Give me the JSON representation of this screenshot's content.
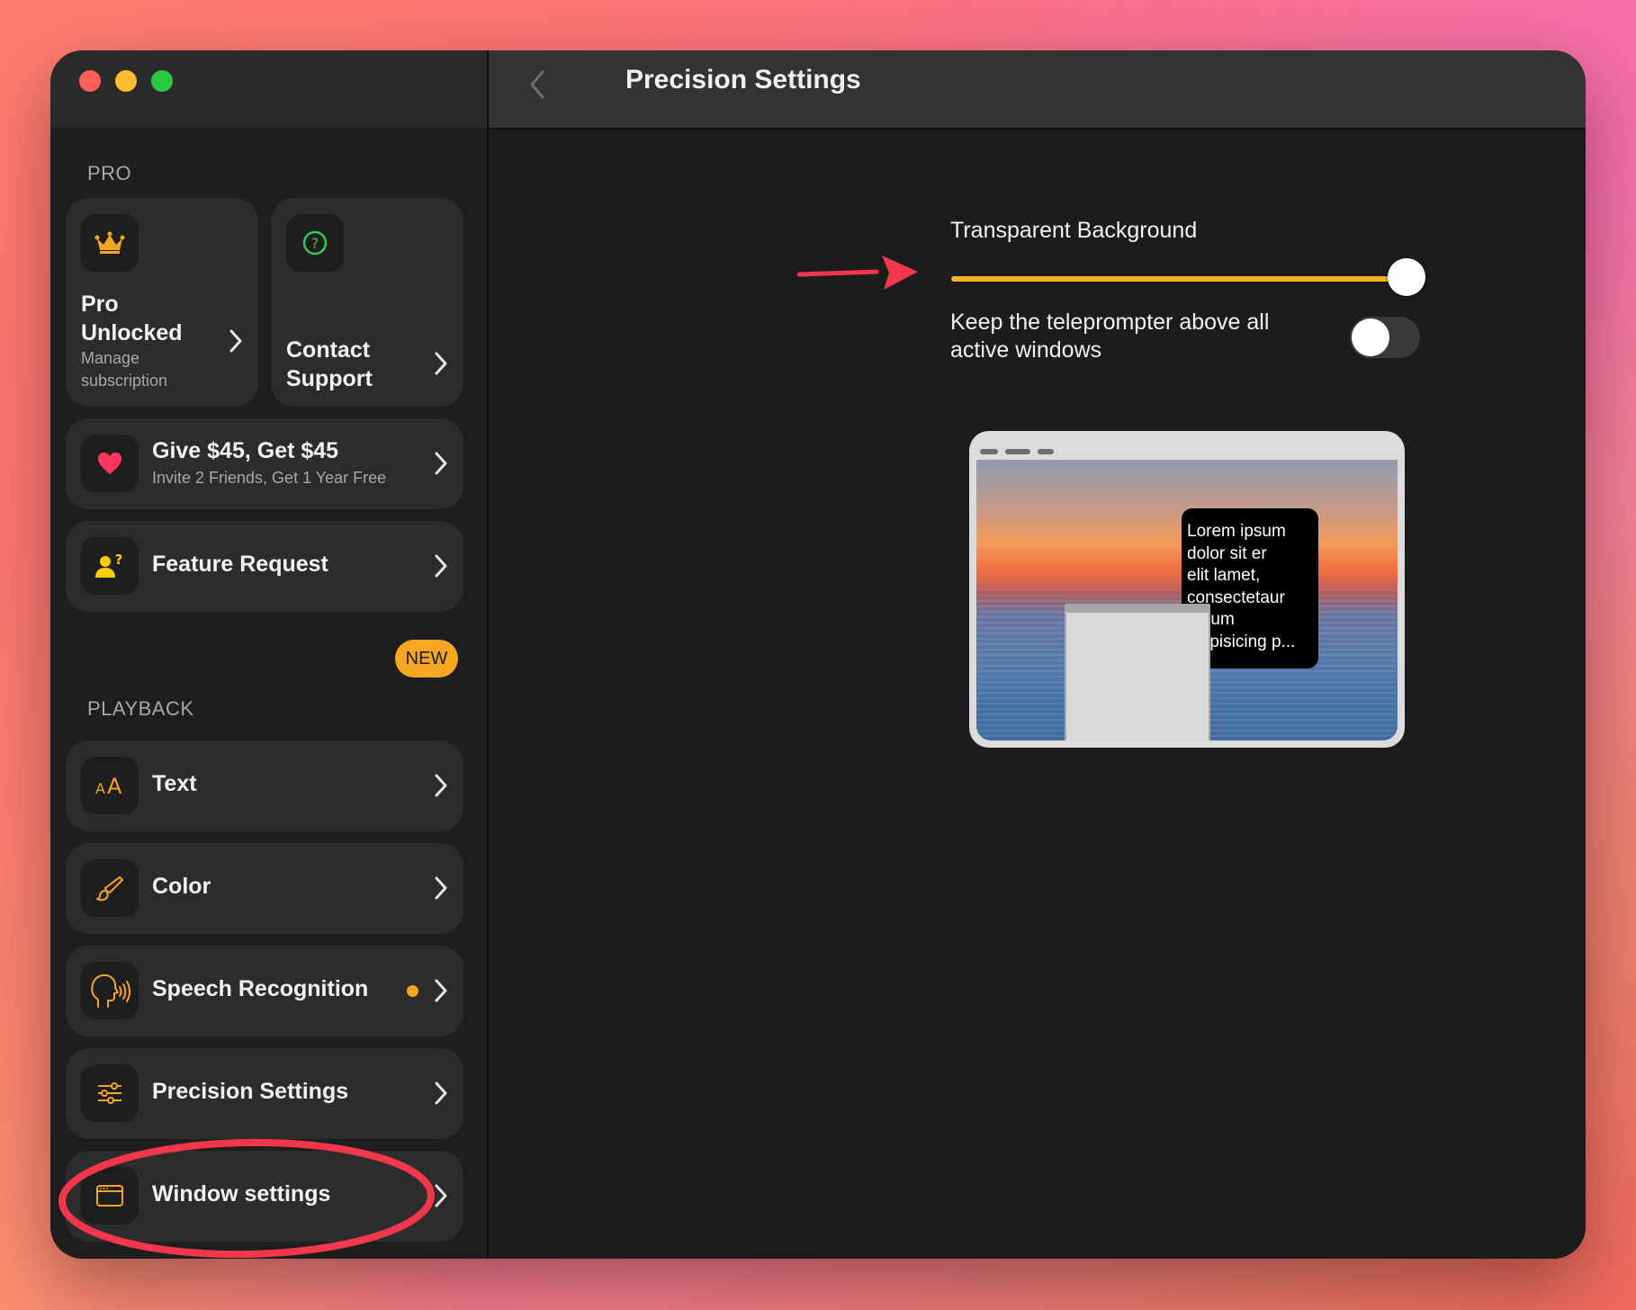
{
  "window": {
    "title": "Precision Settings"
  },
  "sidebar": {
    "pro_section": "PRO",
    "pro_card": {
      "title_line1": "Pro",
      "title_line2": "Unlocked",
      "sub_line1": "Manage",
      "sub_line2": "subscription",
      "icon": "crown-icon"
    },
    "support_card": {
      "title_line1": "Contact",
      "title_line2": "Support",
      "icon": "question-circle-icon"
    },
    "referral": {
      "title": "Give $45, Get $45",
      "subtitle": "Invite 2 Friends, Get 1 Year Free",
      "icon": "heart-icon"
    },
    "feature_request": {
      "title": "Feature Request",
      "icon": "person-question-icon"
    },
    "playback_section": "PLAYBACK",
    "new_badge": "NEW",
    "items": [
      {
        "label": "Text",
        "icon": "text-size-icon"
      },
      {
        "label": "Color",
        "icon": "paintbrush-icon"
      },
      {
        "label": "Speech Recognition",
        "icon": "speaking-head-icon",
        "has_dot": true
      },
      {
        "label": "Precision Settings",
        "icon": "sliders-icon"
      },
      {
        "label": "Window settings",
        "icon": "window-icon"
      }
    ]
  },
  "settings": {
    "transparent_label": "Transparent Background",
    "transparent_value": 1.0,
    "above_label_line1": "Keep the teleprompter above all",
    "above_label_line2": "active windows",
    "above_enabled": false
  },
  "preview": {
    "prompter_lines": [
      "Lorem ipsum",
      "dolor sit er",
      "elit lamet,",
      "consectetaur",
      "cillium",
      "adipisicing p..."
    ]
  },
  "colors": {
    "accent": "#f5a623",
    "annotation": "#f2374d",
    "window_bg": "#1c1c1c",
    "card_bg": "#2c2c2c"
  }
}
